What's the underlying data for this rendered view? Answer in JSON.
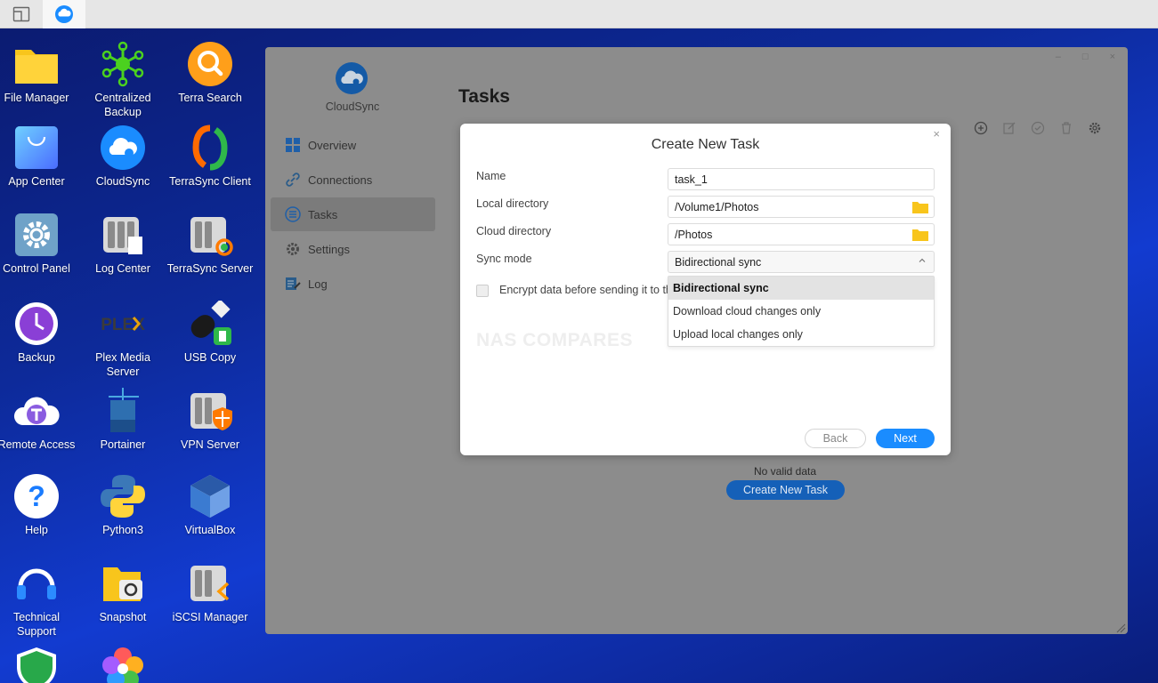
{
  "taskbar": {
    "items": [
      {
        "name": "show-desktop-icon"
      },
      {
        "name": "cloudsync-taskbar-icon"
      }
    ]
  },
  "desktop": {
    "icons": [
      {
        "label": "File Manager",
        "icon": "folder-icon"
      },
      {
        "label": "Centralized Backup",
        "icon": "network-nodes-icon"
      },
      {
        "label": "Terra Search",
        "icon": "magnifier-icon"
      },
      {
        "label": "App Center",
        "icon": "shopping-bag-icon"
      },
      {
        "label": "CloudSync",
        "icon": "cloud-sync-icon"
      },
      {
        "label": "TerraSync Client",
        "icon": "sync-arrows-icon"
      },
      {
        "label": "Control Panel",
        "icon": "gear-icon"
      },
      {
        "label": "Log Center",
        "icon": "log-server-icon"
      },
      {
        "label": "TerraSync Server",
        "icon": "sync-server-icon"
      },
      {
        "label": "Backup",
        "icon": "backup-clock-icon"
      },
      {
        "label": "Plex Media Server",
        "icon": "plex-icon"
      },
      {
        "label": "USB Copy",
        "icon": "usb-drive-icon"
      },
      {
        "label": "Remote Access",
        "icon": "remote-cloud-icon"
      },
      {
        "label": "Portainer",
        "icon": "portainer-icon"
      },
      {
        "label": "VPN Server",
        "icon": "vpn-shield-icon"
      },
      {
        "label": "Help",
        "icon": "question-icon"
      },
      {
        "label": "Python3",
        "icon": "python-icon"
      },
      {
        "label": "VirtualBox",
        "icon": "virtualbox-icon"
      },
      {
        "label": "Technical Support",
        "icon": "headset-icon"
      },
      {
        "label": "Snapshot",
        "icon": "camera-folder-icon"
      },
      {
        "label": "iSCSI Manager",
        "icon": "iscsi-icon"
      },
      {
        "label": "",
        "icon": "security-shield-icon"
      },
      {
        "label": "",
        "icon": "photos-flower-icon"
      }
    ]
  },
  "window": {
    "controls": {
      "minimize": "–",
      "maximize": "□",
      "close": "×"
    },
    "app_name": "CloudSync",
    "nav": [
      {
        "label": "Overview",
        "icon": "overview-grid-icon"
      },
      {
        "label": "Connections",
        "icon": "link-icon"
      },
      {
        "label": "Tasks",
        "icon": "tasks-list-icon",
        "active": true
      },
      {
        "label": "Settings",
        "icon": "settings-gear-icon"
      },
      {
        "label": "Log",
        "icon": "log-edit-icon"
      }
    ],
    "page_title": "Tasks",
    "toolbar": [
      "add-icon",
      "edit-icon",
      "check-icon",
      "delete-icon",
      "settings-icon"
    ],
    "empty_text": "No valid data",
    "create_button": "Create New Task"
  },
  "modal": {
    "title": "Create New Task",
    "close": "×",
    "fields": {
      "name_label": "Name",
      "name_value": "task_1",
      "local_label": "Local directory",
      "local_value": "/Volume1/Photos",
      "cloud_label": "Cloud directory",
      "cloud_value": "/Photos",
      "mode_label": "Sync mode",
      "mode_value": "Bidirectional sync"
    },
    "sync_options": [
      "Bidirectional sync",
      "Download cloud changes only",
      "Upload local changes only"
    ],
    "encrypt_label": "Encrypt data before sending it to the cloud",
    "watermark": "NAS COMPARES",
    "back_button": "Back",
    "next_button": "Next"
  },
  "colors": {
    "accent": "#1a8cff",
    "desktop_bg": "#0d2a9a",
    "window_dim": "#8c8c8c"
  }
}
